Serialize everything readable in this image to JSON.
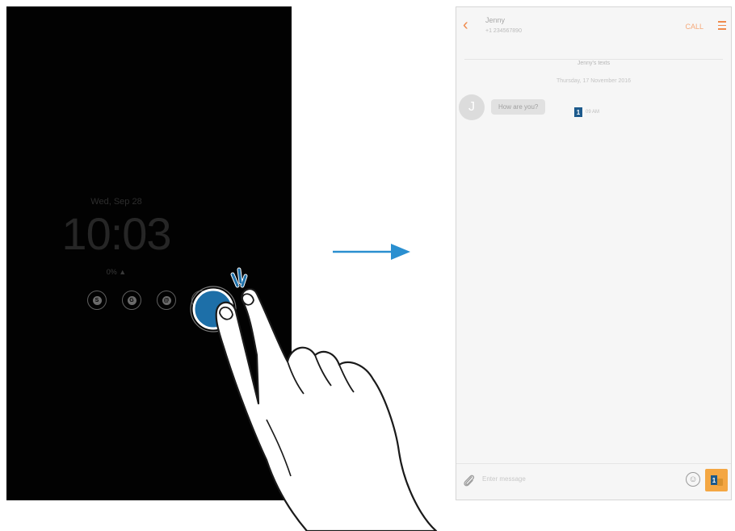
{
  "aod": {
    "date": "Wed, Sep 28",
    "time": "10:03",
    "battery": "0% ▲",
    "notifications": [
      {
        "icon": "S"
      },
      {
        "icon": "G"
      },
      {
        "icon": "@"
      },
      {
        "icon": ""
      }
    ]
  },
  "messages": {
    "header": {
      "back_icon": "‹",
      "contact_name": "Jenny",
      "contact_number": "+1 234567890",
      "call_label": "CALL"
    },
    "separator_label": "Jenny's texts",
    "date": "Thursday, 17 November 2016",
    "thread": [
      {
        "avatar": "J",
        "text": "How are you?",
        "sim": "1",
        "time": "09 AM"
      }
    ],
    "input": {
      "placeholder": "Enter message"
    },
    "send": {
      "sim": "1"
    }
  },
  "colors": {
    "accent": "#f08a4b",
    "sim_blue": "#1d5a8c",
    "send_orange": "#f4a743",
    "arrow_blue": "#2a8fd0"
  }
}
